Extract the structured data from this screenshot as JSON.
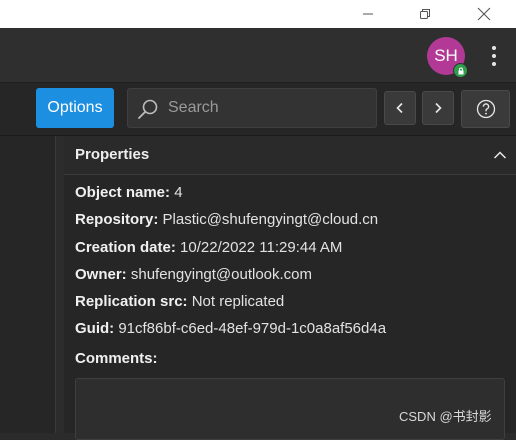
{
  "window": {
    "min_icon": "minimize-icon",
    "restore_icon": "restore-icon",
    "close_icon": "close-icon"
  },
  "header": {
    "avatar_initials": "SH",
    "avatar_color": "#b23a96",
    "avatar_badge_icon": "lock-icon",
    "avatar_badge_color": "#2e9e4c",
    "more_icon": "kebab-menu-icon"
  },
  "toolbar": {
    "options_label": "Options",
    "accent_color": "#1d8fe1",
    "search_placeholder": "Search",
    "prev_icon": "chevron-left-icon",
    "next_icon": "chevron-right-icon",
    "help_icon": "help-circle-icon"
  },
  "properties": {
    "title": "Properties",
    "collapse_icon": "chevron-up-icon",
    "rows": [
      {
        "label": "Object name:",
        "value": "4"
      },
      {
        "label": "Repository:",
        "value": "Plastic@shufengyingt@cloud.cn"
      },
      {
        "label": "Creation date:",
        "value": "10/22/2022 11:29:44 AM"
      },
      {
        "label": "Owner:",
        "value": "shufengyingt@outlook.com"
      },
      {
        "label": "Replication src:",
        "value": "Not replicated"
      },
      {
        "label": "Guid:",
        "value": "91cf86bf-c6ed-48ef-979d-1c0a8af56d4a"
      }
    ],
    "comments_label": "Comments:",
    "comments_value": ""
  },
  "watermark": "CSDN @书封影"
}
